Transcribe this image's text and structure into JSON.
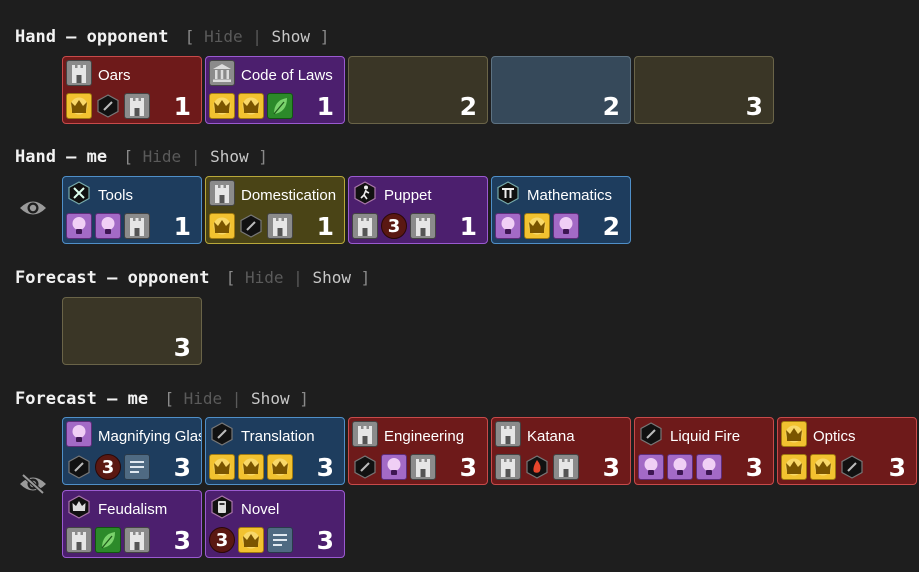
{
  "sections": {
    "hand_opponent": {
      "title": "Hand — opponent",
      "open": "[",
      "hide": "Hide",
      "sep": "|",
      "show": "Show",
      "close": "]"
    },
    "hand_me": {
      "title": "Hand — me",
      "open": "[",
      "hide": "Hide",
      "sep": "|",
      "show": "Show",
      "close": "]"
    },
    "forecast_opponent": {
      "title": "Forecast — opponent",
      "open": "[",
      "hide": "Hide",
      "sep": "|",
      "show": "Show",
      "close": "]"
    },
    "forecast_me": {
      "title": "Forecast — me",
      "open": "[",
      "hide": "Hide",
      "sep": "|",
      "show": "Show",
      "close": "]"
    }
  },
  "hand_opponent": [
    {
      "title": "Oars",
      "color": "red",
      "age": "1",
      "head": "castle",
      "icons": [
        "crown",
        "hex",
        "castle"
      ]
    },
    {
      "title": "Code of Laws",
      "color": "purple",
      "age": "1",
      "head": "temple",
      "icons": [
        "crown",
        "crown",
        "leaf"
      ]
    },
    {
      "title": "",
      "color": "back-olive",
      "age": "2",
      "head": "",
      "icons": []
    },
    {
      "title": "",
      "color": "back-slate",
      "age": "2",
      "head": "",
      "icons": []
    },
    {
      "title": "",
      "color": "back-olive",
      "age": "3",
      "head": "",
      "icons": []
    }
  ],
  "hand_me": [
    {
      "title": "Tools",
      "color": "blue",
      "age": "1",
      "head": "hex-tools",
      "icons": [
        "bulb",
        "bulb",
        "castle"
      ]
    },
    {
      "title": "Domestication",
      "color": "olive",
      "age": "1",
      "head": "castle",
      "icons": [
        "crown",
        "hex",
        "castle"
      ]
    },
    {
      "title": "Puppet",
      "color": "purple",
      "age": "1",
      "head": "hex-figure",
      "icons": [
        "castle",
        "num:3",
        "castle"
      ]
    },
    {
      "title": "Mathematics",
      "color": "blue",
      "age": "2",
      "head": "hex-pi",
      "icons": [
        "bulb",
        "crown",
        "bulb"
      ]
    }
  ],
  "forecast_opponent": [
    {
      "title": "",
      "color": "back-olive",
      "age": "3",
      "head": "",
      "icons": []
    }
  ],
  "forecast_me": [
    {
      "title": "Magnifying Glass",
      "color": "blue",
      "age": "3",
      "head": "bulb",
      "icons": [
        "hex",
        "num:3",
        "doc"
      ]
    },
    {
      "title": "Translation",
      "color": "blue",
      "age": "3",
      "head": "hex",
      "icons": [
        "crown",
        "crown",
        "crown"
      ]
    },
    {
      "title": "Engineering",
      "color": "red",
      "age": "3",
      "head": "castle",
      "icons": [
        "hex",
        "bulb",
        "castle"
      ]
    },
    {
      "title": "Katana",
      "color": "red",
      "age": "3",
      "head": "castle",
      "icons": [
        "castle",
        "hex-fire",
        "castle"
      ]
    },
    {
      "title": "Liquid Fire",
      "color": "red",
      "age": "3",
      "head": "hex",
      "icons": [
        "bulb",
        "bulb",
        "bulb"
      ]
    },
    {
      "title": "Optics",
      "color": "red",
      "age": "3",
      "head": "crown",
      "icons": [
        "crown",
        "crown",
        "hex"
      ]
    },
    {
      "title": "Feudalism",
      "color": "purple",
      "age": "3",
      "head": "hex-crown",
      "icons": [
        "castle",
        "leaf",
        "castle"
      ]
    },
    {
      "title": "Novel",
      "color": "purple",
      "age": "3",
      "head": "hex-doc",
      "icons": [
        "num:3",
        "crown",
        "doc"
      ]
    }
  ]
}
